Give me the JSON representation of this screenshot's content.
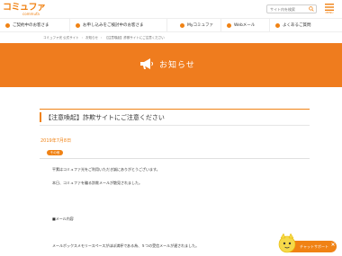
{
  "header": {
    "logo_main": "コミュファ",
    "logo_sub": "commufa",
    "search_placeholder": "サイト内を検索",
    "menu_label": "MENU"
  },
  "nav": {
    "items": [
      {
        "label": "ご契約中のお客さま"
      },
      {
        "label": "お申し込みをご検討中のお客さま"
      },
      {
        "label": "Myコミュファ"
      },
      {
        "label": "Webメール"
      },
      {
        "label": "よくあるご質問"
      }
    ]
  },
  "breadcrumb": [
    "コミュファ光 公式サイト",
    "お知らせ",
    "【注意喚起】詐欺サイトにご注意ください"
  ],
  "hero": {
    "title": "お知らせ"
  },
  "notice": {
    "title": "【注意喚起】詐欺サイトにご注意ください",
    "date": "2019年7月8日",
    "category": "その他",
    "lines": [
      "平素はコミュファ光をご利用いただき誠にありがとうございます。",
      "本日、コミュファを騙る詐欺メールが散見されました。",
      "■メール内容",
      "メールボックスメモリースペースがほぼ満杯である為、５つの受信メールが遅されました。"
    ]
  },
  "chat": {
    "label": "チャットサポート"
  },
  "colors": {
    "brand_orange": "#f08214",
    "hero_orange": "#ef7c1e"
  }
}
